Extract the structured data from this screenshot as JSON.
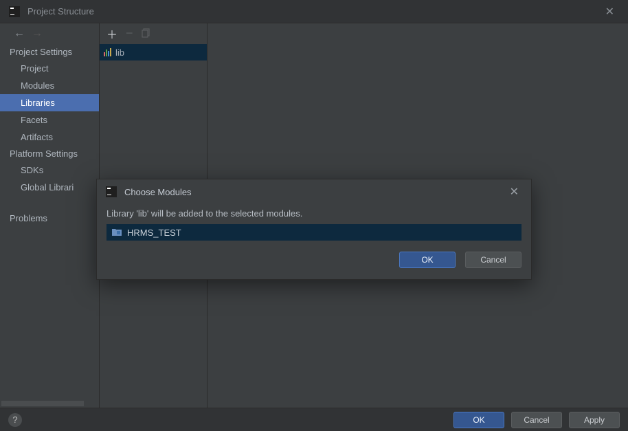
{
  "window": {
    "title": "Project Structure"
  },
  "sidebar": {
    "sections": [
      {
        "label": "Project Settings",
        "type": "header"
      },
      {
        "label": "Project",
        "type": "item"
      },
      {
        "label": "Modules",
        "type": "item"
      },
      {
        "label": "Libraries",
        "type": "item",
        "selected": true
      },
      {
        "label": "Facets",
        "type": "item"
      },
      {
        "label": "Artifacts",
        "type": "item"
      },
      {
        "label": "Platform Settings",
        "type": "header"
      },
      {
        "label": "SDKs",
        "type": "item"
      },
      {
        "label": "Global Librari",
        "type": "item"
      },
      {
        "label": "Problems",
        "type": "item",
        "gapBefore": true
      }
    ]
  },
  "libs": {
    "items": [
      {
        "label": "lib"
      }
    ]
  },
  "bottom": {
    "help": "?",
    "ok": "OK",
    "cancel": "Cancel",
    "apply": "Apply"
  },
  "modal": {
    "title": "Choose Modules",
    "description": "Library 'lib' will be added to the selected modules.",
    "items": [
      {
        "label": "HRMS_TEST"
      }
    ],
    "ok": "OK",
    "cancel": "Cancel"
  }
}
